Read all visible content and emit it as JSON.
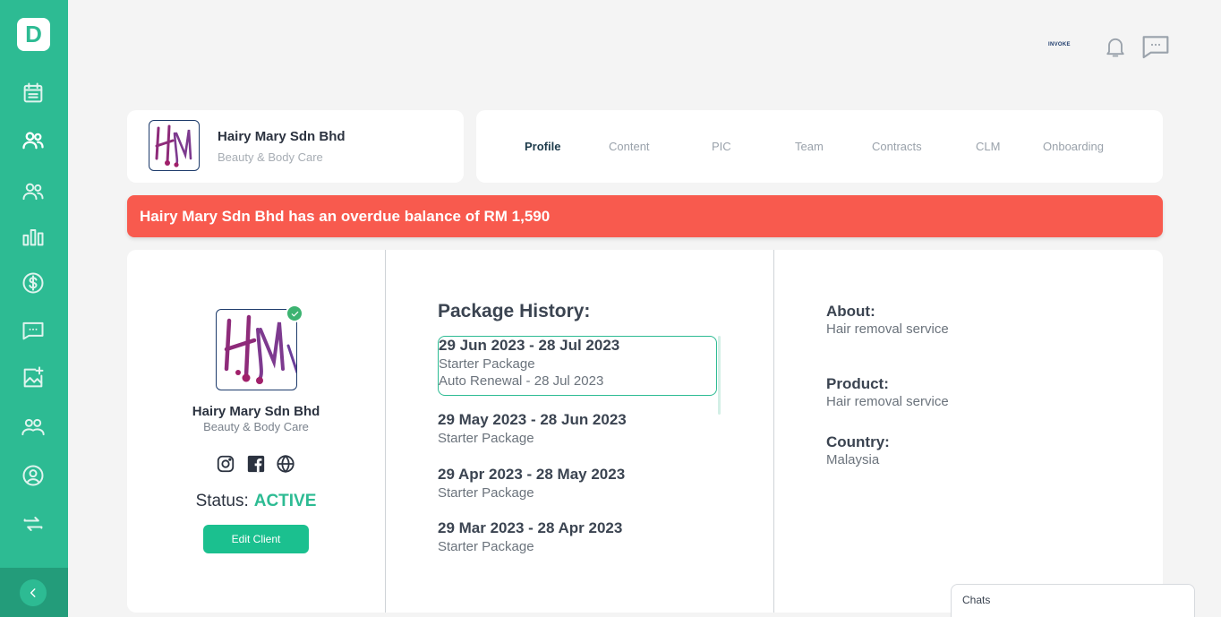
{
  "sidebar": {
    "logo_letter": "D",
    "items": [
      {
        "name": "calendar-icon"
      },
      {
        "name": "clients-icon"
      },
      {
        "name": "users-icon"
      },
      {
        "name": "bar-chart-icon"
      },
      {
        "name": "dollar-icon"
      },
      {
        "name": "chat-icon"
      },
      {
        "name": "image-add-icon"
      },
      {
        "name": "handshake-icon"
      },
      {
        "name": "user-circle-icon"
      },
      {
        "name": "refresh-icon"
      }
    ]
  },
  "topbar": {
    "brand_text": "INVOKE"
  },
  "client": {
    "name": "Hairy Mary Sdn Bhd",
    "category": "Beauty & Body Care"
  },
  "tabs": [
    {
      "label": "Profile",
      "active": true
    },
    {
      "label": "Content"
    },
    {
      "label": "PIC"
    },
    {
      "label": "Team"
    },
    {
      "label": "Contracts"
    },
    {
      "label": "CLM"
    },
    {
      "label": "Onboarding"
    }
  ],
  "alert": {
    "text": "Hairy Mary Sdn Bhd has an overdue balance of RM 1,590"
  },
  "profile": {
    "name": "Hairy Mary Sdn Bhd",
    "category": "Beauty & Body Care",
    "status_label": "Status:",
    "status_value": "ACTIVE",
    "edit_label": "Edit Client"
  },
  "package_history": {
    "title": "Package History:",
    "items": [
      {
        "date": "29 Jun 2023 - 28 Jul 2023",
        "package": "Starter Package",
        "renewal": "Auto Renewal - 28 Jul 2023"
      },
      {
        "date": "29 May 2023 - 28 Jun 2023",
        "package": "Starter Package"
      },
      {
        "date": "29 Apr 2023 - 28 May 2023",
        "package": "Starter Package"
      },
      {
        "date": "29 Mar 2023 - 28 Apr 2023",
        "package": "Starter Package"
      }
    ]
  },
  "info": {
    "about_label": "About:",
    "about_value": "Hair removal service",
    "product_label": "Product:",
    "product_value": "Hair removal service",
    "country_label": "Country:",
    "country_value": "Malaysia"
  },
  "chats": {
    "label": "Chats"
  },
  "colors": {
    "brand": "#2dbb93",
    "alert": "#f85a4e",
    "button": "#1bc08f"
  }
}
